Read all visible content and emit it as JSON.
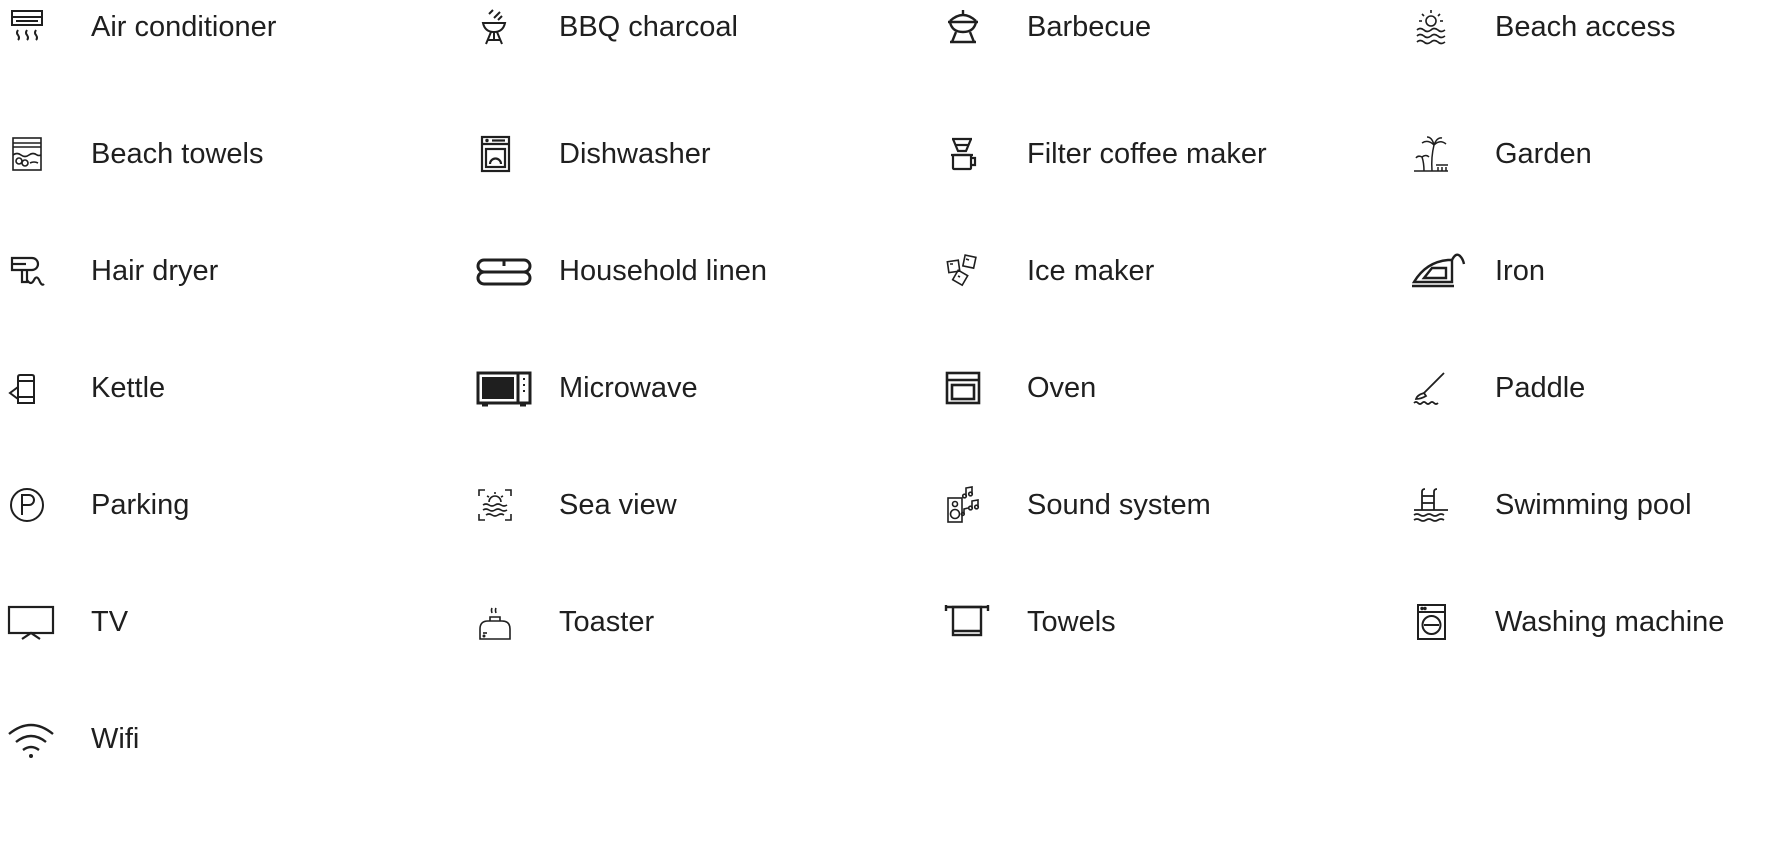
{
  "amenities": [
    {
      "label": "Air conditioner",
      "icon": "air-conditioner-icon"
    },
    {
      "label": "BBQ charcoal",
      "icon": "bbq-charcoal-icon"
    },
    {
      "label": "Barbecue",
      "icon": "barbecue-icon"
    },
    {
      "label": "Beach access",
      "icon": "beach-access-icon"
    },
    {
      "label": "Beach towels",
      "icon": "beach-towels-icon"
    },
    {
      "label": "Dishwasher",
      "icon": "dishwasher-icon"
    },
    {
      "label": "Filter coffee maker",
      "icon": "filter-coffee-maker-icon"
    },
    {
      "label": "Garden",
      "icon": "garden-icon"
    },
    {
      "label": "Hair dryer",
      "icon": "hair-dryer-icon"
    },
    {
      "label": "Household linen",
      "icon": "household-linen-icon"
    },
    {
      "label": "Ice maker",
      "icon": "ice-maker-icon"
    },
    {
      "label": "Iron",
      "icon": "iron-icon"
    },
    {
      "label": "Kettle",
      "icon": "kettle-icon"
    },
    {
      "label": "Microwave",
      "icon": "microwave-icon"
    },
    {
      "label": "Oven",
      "icon": "oven-icon"
    },
    {
      "label": "Paddle",
      "icon": "paddle-icon"
    },
    {
      "label": "Parking",
      "icon": "parking-icon"
    },
    {
      "label": "Sea view",
      "icon": "sea-view-icon"
    },
    {
      "label": "Sound system",
      "icon": "sound-system-icon"
    },
    {
      "label": "Swimming pool",
      "icon": "swimming-pool-icon"
    },
    {
      "label": "TV",
      "icon": "tv-icon"
    },
    {
      "label": "Toaster",
      "icon": "toaster-icon"
    },
    {
      "label": "Towels",
      "icon": "towels-icon"
    },
    {
      "label": "Washing machine",
      "icon": "washing-machine-icon"
    },
    {
      "label": "Wifi",
      "icon": "wifi-icon"
    }
  ],
  "colors": {
    "text": "#1f1f1f",
    "icon_stroke": "#1f1f1f",
    "background": "#ffffff"
  }
}
